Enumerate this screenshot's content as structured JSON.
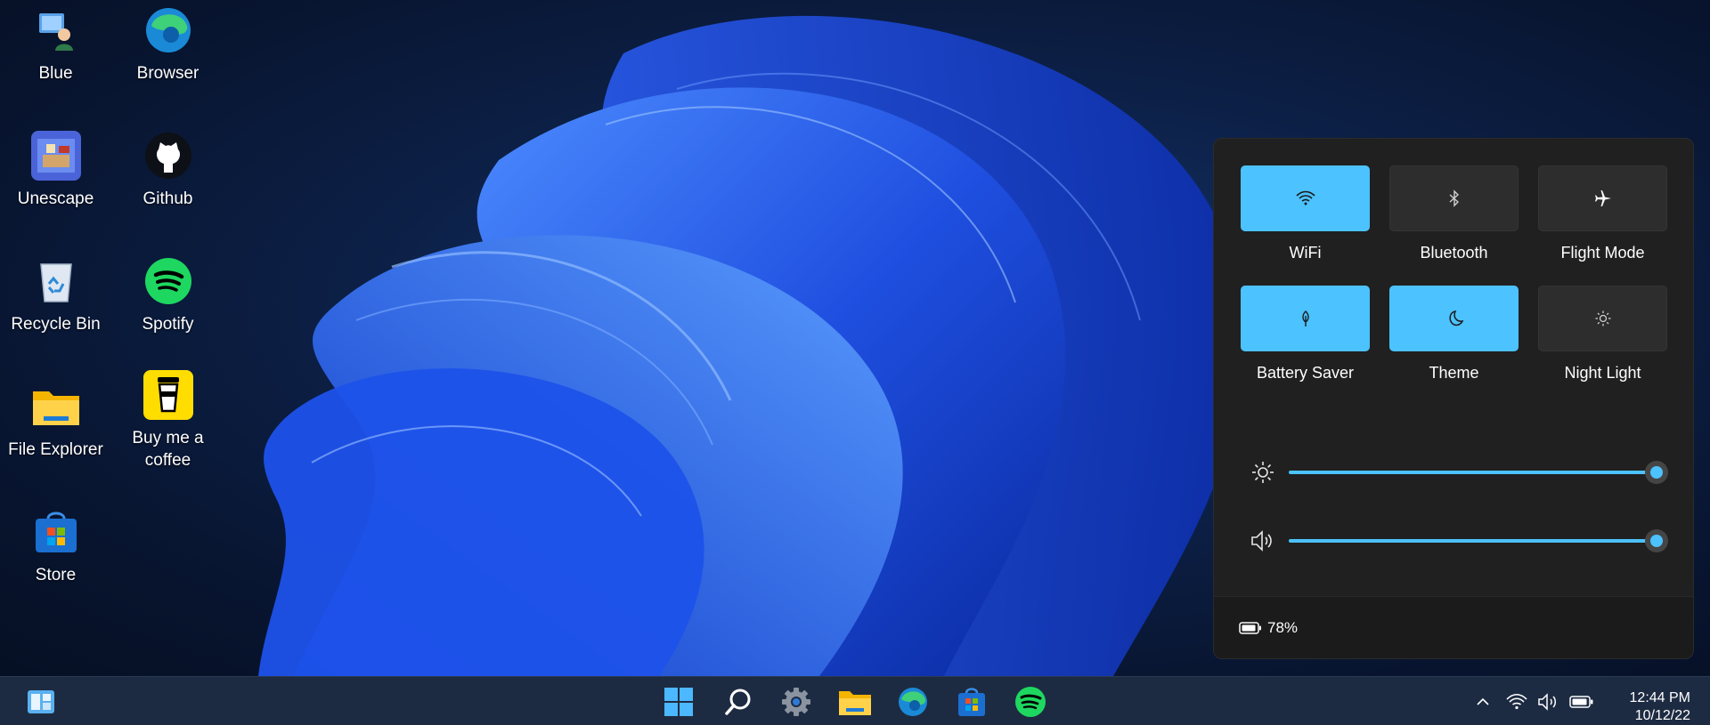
{
  "desktop": {
    "icons": [
      {
        "label": "Blue",
        "icon": "user-pc-icon"
      },
      {
        "label": "Browser",
        "icon": "edge-icon"
      },
      {
        "label": "Unescape",
        "icon": "unescape-game-icon"
      },
      {
        "label": "Github",
        "icon": "github-icon"
      },
      {
        "label": "Recycle Bin",
        "icon": "recycle-bin-icon"
      },
      {
        "label": "Spotify",
        "icon": "spotify-icon"
      },
      {
        "label": "File Explorer",
        "icon": "folder-icon"
      },
      {
        "label": "Buy me a coffee",
        "icon": "coffee-icon"
      },
      {
        "label": "Store",
        "icon": "store-icon"
      }
    ]
  },
  "quick_settings": {
    "tiles": [
      {
        "label": "WiFi",
        "icon": "wifi-icon",
        "active": true
      },
      {
        "label": "Bluetooth",
        "icon": "bluetooth-icon",
        "active": false
      },
      {
        "label": "Flight Mode",
        "icon": "airplane-icon",
        "active": false
      },
      {
        "label": "Battery Saver",
        "icon": "battery-saver-icon",
        "active": true
      },
      {
        "label": "Theme",
        "icon": "moon-icon",
        "active": true
      },
      {
        "label": "Night Light",
        "icon": "sun-small-icon",
        "active": false
      }
    ],
    "brightness": {
      "icon": "brightness-icon",
      "value": 1.0
    },
    "volume": {
      "icon": "speaker-icon",
      "value": 1.0
    },
    "battery": {
      "percent": "78%",
      "icon": "battery-icon"
    },
    "accent_color": "#4cc2ff"
  },
  "taskbar": {
    "widgets_icon": "widgets-icon",
    "center_icons": [
      "start-icon",
      "search-icon",
      "settings-icon",
      "file-explorer-icon",
      "edge-icon",
      "store-icon",
      "spotify-icon"
    ],
    "tray_icons": [
      "chevron-up-icon",
      "wifi-icon",
      "speaker-icon",
      "battery-icon"
    ],
    "time": "12:44 PM",
    "date": "10/12/22"
  }
}
